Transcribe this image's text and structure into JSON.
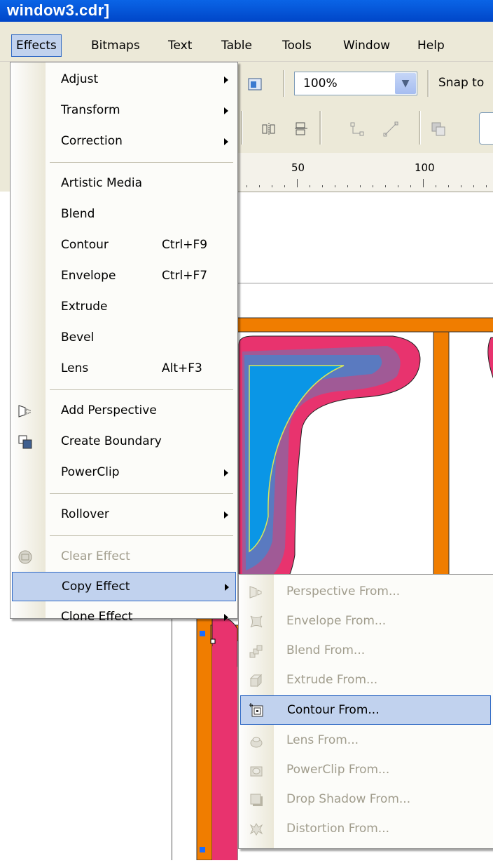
{
  "titlebar": {
    "text": "window3.cdr]"
  },
  "menubar": {
    "items": [
      {
        "label": "Effects"
      },
      {
        "label": "Bitmaps"
      },
      {
        "label": "Text"
      },
      {
        "label": "Table"
      },
      {
        "label": "Tools"
      },
      {
        "label": "Window"
      },
      {
        "label": "Help"
      }
    ]
  },
  "toolbar": {
    "zoom_value": "100%",
    "snap_label": "Snap to"
  },
  "ruler": {
    "labels": [
      "50",
      "100"
    ]
  },
  "effects_menu": {
    "items": [
      {
        "label": "Adjust"
      },
      {
        "label": "Transform"
      },
      {
        "label": "Correction"
      },
      {
        "label": "Artistic Media"
      },
      {
        "label": "Blend"
      },
      {
        "label": "Contour",
        "shortcut": "Ctrl+F9"
      },
      {
        "label": "Envelope",
        "shortcut": "Ctrl+F7"
      },
      {
        "label": "Extrude"
      },
      {
        "label": "Bevel"
      },
      {
        "label": "Lens",
        "shortcut": "Alt+F3"
      },
      {
        "label": "Add Perspective"
      },
      {
        "label": "Create Boundary"
      },
      {
        "label": "PowerClip"
      },
      {
        "label": "Rollover"
      },
      {
        "label": "Clear Effect"
      },
      {
        "label": "Copy Effect"
      },
      {
        "label": "Clone Effect"
      }
    ]
  },
  "copy_effect_submenu": {
    "items": [
      {
        "label": "Perspective From..."
      },
      {
        "label": "Envelope From..."
      },
      {
        "label": "Blend From..."
      },
      {
        "label": "Extrude From..."
      },
      {
        "label": "Contour From..."
      },
      {
        "label": "Lens From..."
      },
      {
        "label": "PowerClip From..."
      },
      {
        "label": "Drop Shadow From..."
      },
      {
        "label": "Distortion From..."
      }
    ]
  },
  "colors": {
    "titlebar": "#0054e3",
    "highlight": "#c1d2ee",
    "highlight_border": "#316ac5",
    "orange": "#f07d00",
    "pink": "#e8336e",
    "contour_purple": "#a05a96",
    "contour_blue": "#5a7ac0",
    "fill_cyan": "#0a96e6"
  }
}
